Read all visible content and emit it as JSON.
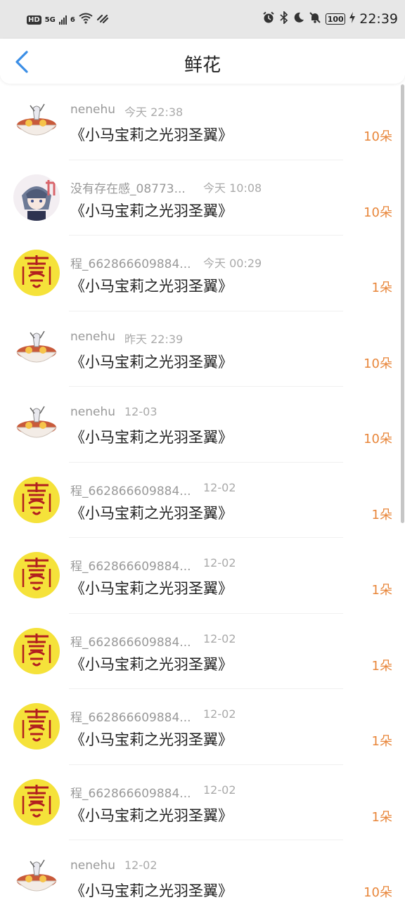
{
  "status_bar": {
    "left": {
      "hd": "HD",
      "network": "5G",
      "sim2": "6"
    },
    "battery": "100",
    "time": "22:39"
  },
  "header": {
    "title": "鲜花",
    "back_icon": "chevron-left-icon"
  },
  "colors": {
    "accent": "#e8863a",
    "back": "#3a8ee6",
    "muted": "#999999"
  },
  "rows": [
    {
      "avatar": "ramen",
      "name": "nenehu",
      "time": "今天 22:38",
      "title": "《小马宝莉之光羽圣翼》",
      "count": "10朵"
    },
    {
      "avatar": "anime",
      "name": "没有存在感_08773...",
      "time": "今天 10:08",
      "title": "《小马宝莉之光羽圣翼》",
      "count": "10朵"
    },
    {
      "avatar": "seal",
      "name": "程_662866609884...",
      "time": "今天 00:29",
      "title": "《小马宝莉之光羽圣翼》",
      "count": "1朵"
    },
    {
      "avatar": "ramen",
      "name": "nenehu",
      "time": "昨天 22:39",
      "title": "《小马宝莉之光羽圣翼》",
      "count": "10朵"
    },
    {
      "avatar": "ramen",
      "name": "nenehu",
      "time": "12-03",
      "title": "《小马宝莉之光羽圣翼》",
      "count": "10朵"
    },
    {
      "avatar": "seal",
      "name": "程_662866609884...",
      "time": "12-02",
      "title": "《小马宝莉之光羽圣翼》",
      "count": "1朵"
    },
    {
      "avatar": "seal",
      "name": "程_662866609884...",
      "time": "12-02",
      "title": "《小马宝莉之光羽圣翼》",
      "count": "1朵"
    },
    {
      "avatar": "seal",
      "name": "程_662866609884...",
      "time": "12-02",
      "title": "《小马宝莉之光羽圣翼》",
      "count": "1朵"
    },
    {
      "avatar": "seal",
      "name": "程_662866609884...",
      "time": "12-02",
      "title": "《小马宝莉之光羽圣翼》",
      "count": "1朵"
    },
    {
      "avatar": "seal",
      "name": "程_662866609884...",
      "time": "12-02",
      "title": "《小马宝莉之光羽圣翼》",
      "count": "1朵"
    },
    {
      "avatar": "ramen",
      "name": "nenehu",
      "time": "12-02",
      "title": "《小马宝莉之光羽圣翼》",
      "count": "10朵"
    }
  ]
}
